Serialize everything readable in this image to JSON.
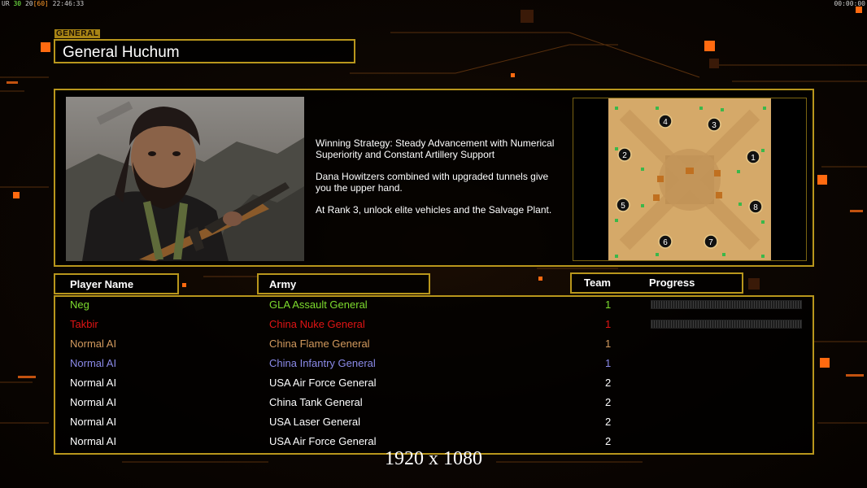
{
  "hud": {
    "left_prefix": "UR",
    "fps": "30",
    "fps_frames": "20",
    "fps_limit": "[60]",
    "clock": "22:46:33",
    "timer": "00:00:00"
  },
  "general": {
    "label": "GENERAL",
    "name": "General Huchum"
  },
  "strategy": [
    "Winning Strategy: Steady Advancement with Numerical\n Superiority and Constant Artillery Support",
    "Dana Howitzers combined with upgraded tunnels give\n you the upper hand.",
    "At Rank 3, unlock elite vehicles and the Salvage Plant."
  ],
  "map": {
    "start_positions": [
      "1",
      "2",
      "3",
      "4",
      "5",
      "6",
      "7",
      "8"
    ]
  },
  "table": {
    "headers": {
      "player_name": "Player Name",
      "army": "Army",
      "team": "Team",
      "progress": "Progress"
    },
    "rows": [
      {
        "player": "Neg",
        "army": "GLA Assault General",
        "team": "1",
        "color": "#7ddc2e",
        "progress": 0
      },
      {
        "player": "Takbir",
        "army": "China Nuke General",
        "team": "1",
        "color": "#e01414",
        "progress": 0
      },
      {
        "player": "Normal AI",
        "army": "China Flame General",
        "team": "1",
        "color": "#d29a5e",
        "progress": null
      },
      {
        "player": "Normal AI",
        "army": "China Infantry General",
        "team": "1",
        "color": "#8a8ae8",
        "progress": null
      },
      {
        "player": "Normal AI",
        "army": "USA Air Force General",
        "team": "2",
        "color": "#ffffff",
        "progress": null
      },
      {
        "player": "Normal AI",
        "army": "China Tank General",
        "team": "2",
        "color": "#ffffff",
        "progress": null
      },
      {
        "player": "Normal AI",
        "army": "USA Laser General",
        "team": "2",
        "color": "#ffffff",
        "progress": null
      },
      {
        "player": "Normal AI",
        "army": "USA Air Force General",
        "team": "2",
        "color": "#ffffff",
        "progress": null
      }
    ]
  },
  "resolution": "1920 x 1080",
  "colors": {
    "frame": "#b8961c",
    "accent": "#ff7a1a"
  }
}
